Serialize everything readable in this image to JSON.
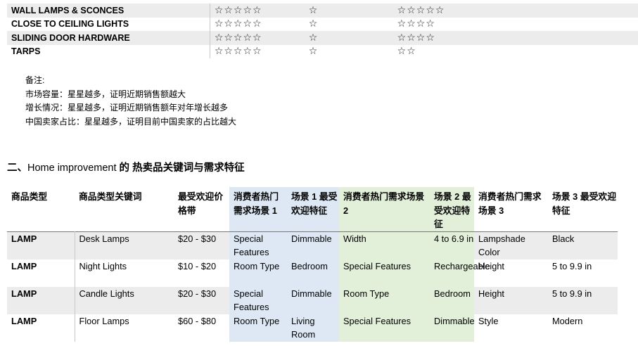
{
  "star_char": "☆",
  "rating_rows": [
    {
      "category": "WALL LAMPS & SCONCES",
      "market": 5,
      "growth": 1,
      "china": 5
    },
    {
      "category": "CLOSE TO CEILING LIGHTS",
      "market": 5,
      "growth": 1,
      "china": 4
    },
    {
      "category": "SLIDING DOOR HARDWARE",
      "market": 5,
      "growth": 1,
      "china": 4
    },
    {
      "category": "TARPS",
      "market": 5,
      "growth": 1,
      "china": 2
    }
  ],
  "notes": {
    "title": "备注:",
    "lines": [
      "市场容量：星星越多，证明近期销售额越大",
      "增长情况：星星越多，证明近期销售额年对年增长越多",
      "中国卖家占比：星星越多，证明目前中国卖家的占比越大"
    ]
  },
  "section": {
    "prefix": "二、",
    "en": "Home improvement",
    "suffix": " 的  热卖品关键词与需求特征"
  },
  "table": {
    "headers": [
      "商品类型",
      "商品类型关键词",
      "最受欢迎价格带",
      "消费者热门需求场景 1",
      "场景 1 最受欢迎特征",
      "消费者热门需求场景 2",
      "场景 2 最受欢迎特征",
      "消费者热门需求场景 3",
      "场景 3 最受欢迎特征"
    ],
    "rows": [
      [
        "LAMP",
        "Desk Lamps",
        "$20 - $30",
        "Special Features",
        "Dimmable",
        "Width",
        "4 to 6.9 in",
        "Lampshade Color",
        "Black"
      ],
      [
        "LAMP",
        "Night Lights",
        "$10 - $20",
        "Room Type",
        "Bedroom",
        "Special Features",
        "Rechargeable",
        "Height",
        "5 to 9.9 in"
      ],
      [
        "LAMP",
        "Candle Lights",
        "$20 - $30",
        "Special Features",
        "Dimmable",
        "Room Type",
        "Bedroom",
        "Height",
        "5 to 9.9 in"
      ],
      [
        "LAMP",
        "Floor Lamps",
        "$60 - $80",
        "Room Type",
        "Living Room",
        "Special Features",
        "Dimmable",
        "Style",
        "Modern"
      ]
    ]
  },
  "colors": {
    "row_shade": "#ececec",
    "scene1_blue": "#dde8f4",
    "scene2_green": "#e2efd9"
  }
}
